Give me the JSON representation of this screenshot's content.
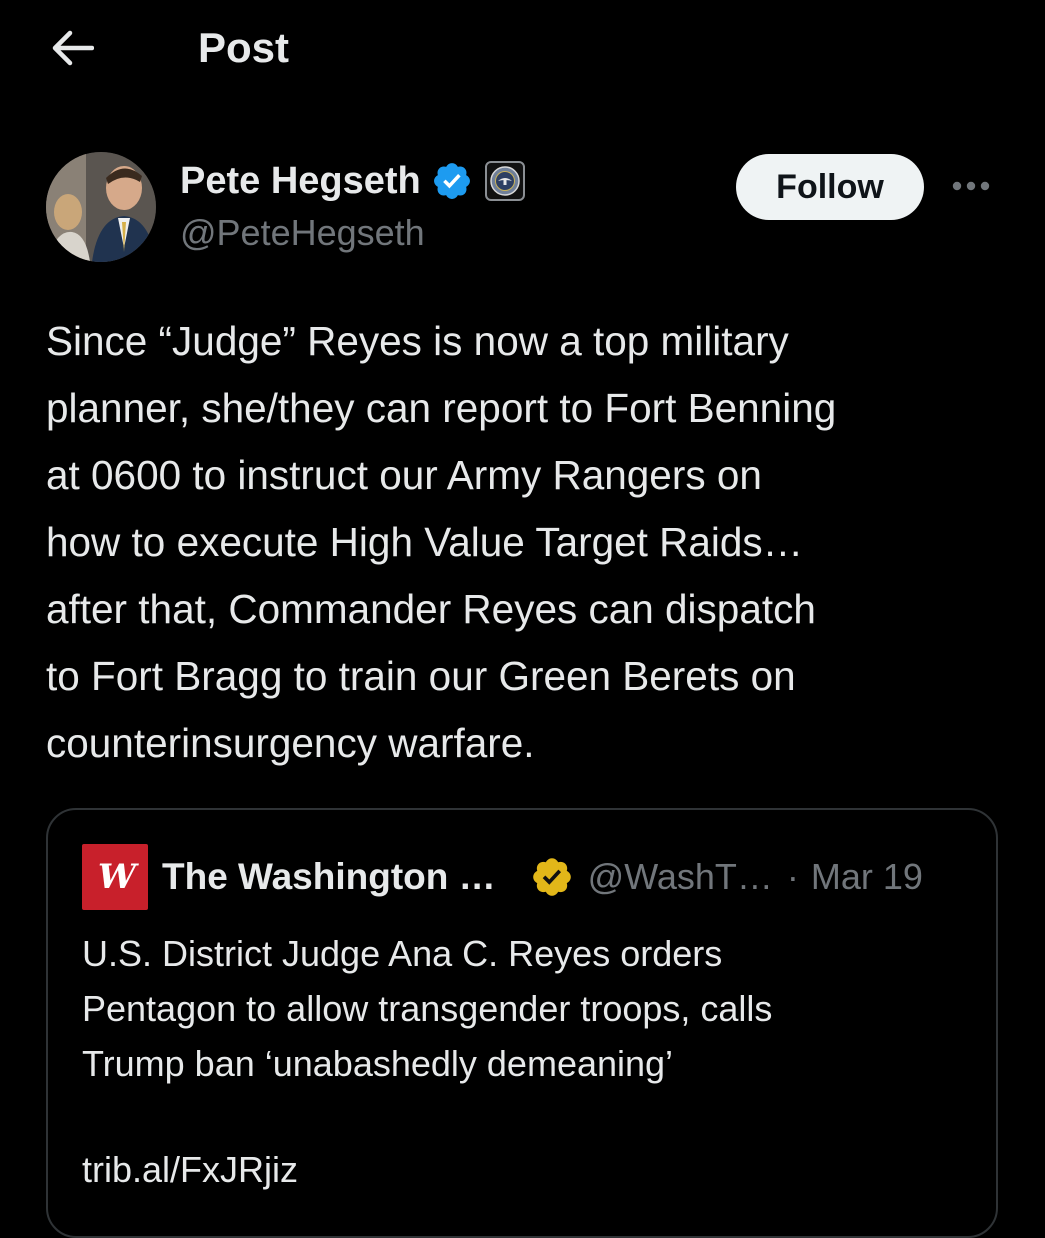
{
  "header": {
    "title": "Post",
    "back_icon": "arrow-left-icon"
  },
  "author": {
    "display_name": "Pete Hegseth",
    "handle": "@PeteHegseth",
    "verified_icon": "verified-badge-icon",
    "affiliation_icon": "department-of-defense-seal-icon"
  },
  "actions": {
    "follow_label": "Follow",
    "more_icon": "more-options-icon"
  },
  "post": {
    "text": "Since “Judge” Reyes is now a top military\nplanner, she/they can report to Fort Benning\nat 0600 to instruct our Army Rangers on\nhow to execute High Value Target Raids…\nafter that, Commander Reyes can dispatch\nto Fort Bragg to train our Green Berets on\ncounterinsurgency warfare."
  },
  "quote": {
    "logo_text": "W",
    "name": "The Washington …",
    "handle": "@WashT…",
    "separator": "·",
    "date": "Mar 19",
    "text": "U.S. District Judge Ana C. Reyes orders\nPentagon to allow transgender troops, calls\nTrump ban ‘unabashedly demeaning’",
    "link": "trib.al/FxJRjiz"
  },
  "colors": {
    "background": "#000000",
    "text_primary": "#e7e9ea",
    "text_secondary": "#71767b",
    "verified_blue": "#1d9bf0",
    "verified_gold": "#e2b719",
    "border": "#2f3336",
    "follow_bg": "#eff3f4",
    "logo_red": "#c8202b"
  }
}
